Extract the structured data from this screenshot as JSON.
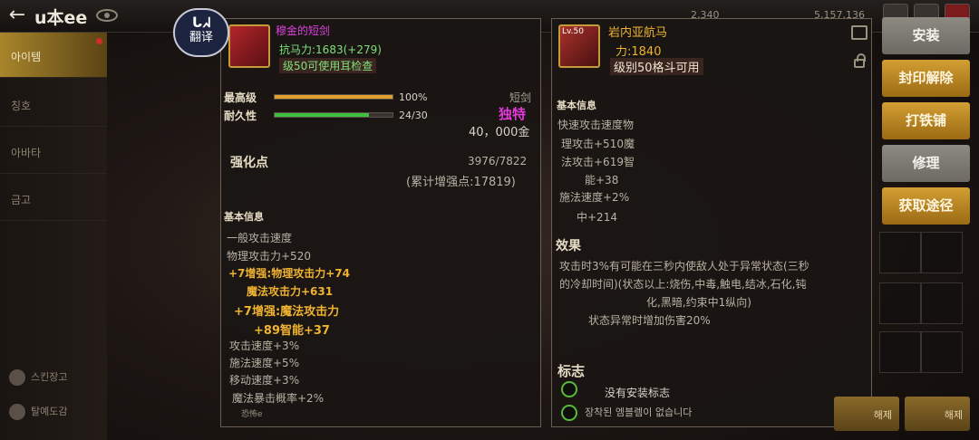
{
  "topbar": {
    "back": "←",
    "title": "u本ee",
    "gold_left": "2,340",
    "gold_right": "5,157,136"
  },
  "sidebar": {
    "tabs": [
      "아이템",
      "칭호",
      "아바타",
      "금고"
    ],
    "bottom": [
      "스킨장고",
      "탈예도감"
    ]
  },
  "translate": {
    "logo": "ᒐᖽ",
    "label": "翻译"
  },
  "left_panel": {
    "item_name": "穆金的短剑",
    "stat_line": "抗马力:1683(+279)",
    "level_req": "级50可使用耳检查",
    "max_level_label": "最高级",
    "max_level_value": "100%",
    "max_level_pct": 100,
    "durability_label": "耐久性",
    "durability_value": "24/30",
    "durability_pct": 80,
    "weapon_type": "短剑",
    "rarity": "独特",
    "price": "40，000金",
    "reinforce_label": "强化点",
    "reinforce_value": "3976/7822",
    "reinforce_total": "(累计增强点:17819)",
    "basic_info_title": "基本信息",
    "lines": [
      {
        "text": "一般攻击速度",
        "style": "stat"
      },
      {
        "text": "物理攻击力+520",
        "style": "stat"
      },
      {
        "text": "+7增强:物理攻击力+74",
        "style": "gold"
      },
      {
        "text": "魔法攻击力+631",
        "style": "gold"
      },
      {
        "text": "+7增强:魔法攻击力",
        "style": "gold"
      },
      {
        "text": "+89智能+37",
        "style": "gold"
      },
      {
        "text": "攻击速度+3%",
        "style": "stat"
      },
      {
        "text": "施法速度+5%",
        "style": "stat"
      },
      {
        "text": "移动速度+3%",
        "style": "stat"
      },
      {
        "text": "魔法暴击概率+2%",
        "style": "stat"
      },
      {
        "text": "恐怖e",
        "style": "small"
      }
    ]
  },
  "right_panel": {
    "level_badge": "Lv.50",
    "item_name": "岩内亚航马",
    "stat_line": "力:1840",
    "level_req": "级别50格斗可用",
    "basic_info_title": "基本信息",
    "lines": [
      "快速攻击速度物",
      "理攻击+510魔",
      "法攻击+619智",
      "能+38",
      "施法速度+2%",
      "中+214"
    ],
    "effect_title": "效果",
    "effect_lines": [
      "攻击时3%有可能在三秒内使敌人处于异常状态(三秒",
      "的冷却时间)(状态以上:烧伤,中毒,触电,结冰,石化,钝",
      "化,黑暗,约束中1纵向)",
      "状态异常时增加伤害20%"
    ],
    "emblem_title": "标志",
    "emblem_lines": [
      "没有安装标志",
      "장착된 엠블렘이 없습니다"
    ]
  },
  "buttons": [
    {
      "label": "安装",
      "style": "grey"
    },
    {
      "label": "封印解除",
      "style": "gold"
    },
    {
      "label": "打铁铺",
      "style": "gold"
    },
    {
      "label": "修理",
      "style": "grey"
    },
    {
      "label": "获取途径",
      "style": "gold"
    }
  ],
  "bottom_buttons": [
    "해제",
    "해제"
  ],
  "colors": {
    "accent_gold": "#f0b330",
    "rarity_magenta": "#e23ad8",
    "name_magenta": "#e040e0",
    "req_green": "#7fe07a"
  }
}
